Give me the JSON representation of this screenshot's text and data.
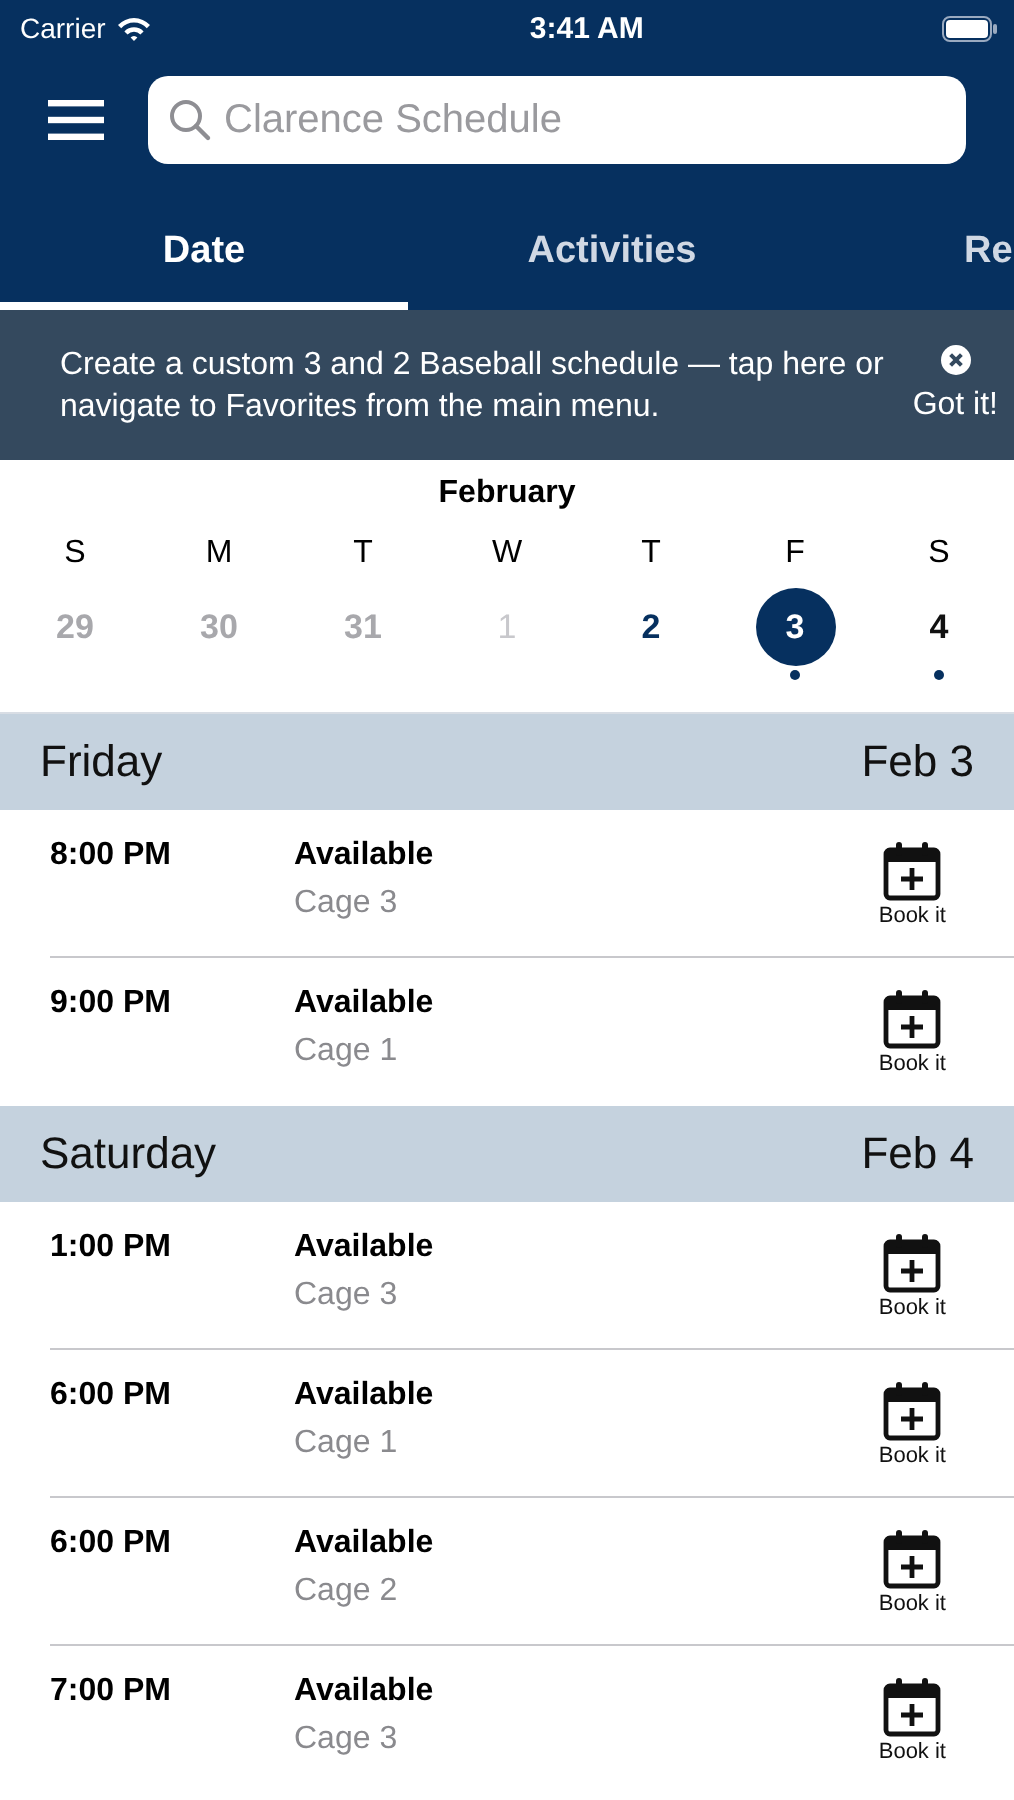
{
  "status_bar": {
    "carrier": "Carrier",
    "time": "3:41 AM"
  },
  "search": {
    "placeholder": "Clarence Schedule"
  },
  "tabs": [
    {
      "label": "Date",
      "selected": true
    },
    {
      "label": "Activities",
      "selected": false
    },
    {
      "label": "Re",
      "selected": false
    }
  ],
  "banner": {
    "message": "Create a custom 3 and 2 Baseball schedule — tap here or navigate to Favorites from the main menu.",
    "dismiss": "Got it!"
  },
  "calendar": {
    "month": "February",
    "weekdays": [
      "S",
      "M",
      "T",
      "W",
      "T",
      "F",
      "S"
    ],
    "days": [
      {
        "label": "29",
        "kind": "past",
        "selected": false,
        "dot": false
      },
      {
        "label": "30",
        "kind": "past",
        "selected": false,
        "dot": false
      },
      {
        "label": "31",
        "kind": "past",
        "selected": false,
        "dot": false
      },
      {
        "label": "1",
        "kind": "dim",
        "selected": false,
        "dot": false
      },
      {
        "label": "2",
        "kind": "event",
        "selected": false,
        "dot": false
      },
      {
        "label": "3",
        "kind": "event",
        "selected": true,
        "dot": true
      },
      {
        "label": "4",
        "kind": "normal",
        "selected": false,
        "dot": true
      }
    ]
  },
  "sections": [
    {
      "day": "Friday",
      "date": "Feb 3",
      "slots": [
        {
          "time": "8:00 PM",
          "status": "Available",
          "place": "Cage 3",
          "action": "Book it"
        },
        {
          "time": "9:00 PM",
          "status": "Available",
          "place": "Cage 1",
          "action": "Book it"
        }
      ]
    },
    {
      "day": "Saturday",
      "date": "Feb 4",
      "slots": [
        {
          "time": "1:00 PM",
          "status": "Available",
          "place": "Cage 3",
          "action": "Book it"
        },
        {
          "time": "6:00 PM",
          "status": "Available",
          "place": "Cage 1",
          "action": "Book it"
        },
        {
          "time": "6:00 PM",
          "status": "Available",
          "place": "Cage 2",
          "action": "Book it"
        },
        {
          "time": "7:00 PM",
          "status": "Available",
          "place": "Cage 3",
          "action": "Book it"
        }
      ]
    }
  ]
}
